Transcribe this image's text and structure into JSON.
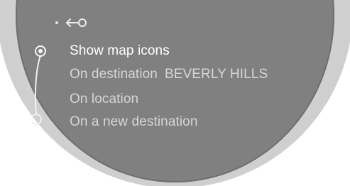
{
  "header": {
    "back_icon": "back-arrow-icon"
  },
  "menu": {
    "items": [
      {
        "label": "Show map icons",
        "selected": true
      },
      {
        "label": "On destination",
        "value": "BEVERLY HILLS"
      },
      {
        "label": "On location"
      },
      {
        "label": "On a new destination"
      }
    ]
  },
  "colors": {
    "screen": "#808080",
    "bezel": "#cfcfcf",
    "text": "#e9e9e9"
  }
}
